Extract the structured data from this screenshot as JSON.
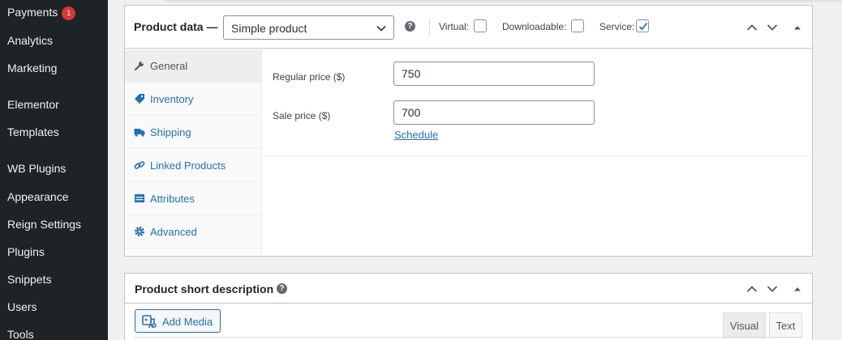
{
  "sidebar": {
    "items": [
      {
        "label": "Payments",
        "badge": "1"
      },
      {
        "label": "Analytics"
      },
      {
        "label": "Marketing"
      },
      {
        "label": "Elementor"
      },
      {
        "label": "Templates"
      },
      {
        "label": "WB Plugins"
      },
      {
        "label": "Appearance"
      },
      {
        "label": "Reign Settings"
      },
      {
        "label": "Plugins"
      },
      {
        "label": "Snippets"
      },
      {
        "label": "Users"
      },
      {
        "label": "Tools"
      }
    ]
  },
  "product_data": {
    "title": "Product data —",
    "type_select": {
      "selected": "Simple product"
    },
    "checkboxes": [
      {
        "label": "Virtual:",
        "checked": false
      },
      {
        "label": "Downloadable:",
        "checked": false
      },
      {
        "label": "Service:",
        "checked": true
      }
    ],
    "tabs": [
      {
        "label": "General",
        "icon": "wrench-icon",
        "active": true
      },
      {
        "label": "Inventory",
        "icon": "tag-icon"
      },
      {
        "label": "Shipping",
        "icon": "truck-icon"
      },
      {
        "label": "Linked Products",
        "icon": "link-icon"
      },
      {
        "label": "Attributes",
        "icon": "table-icon"
      },
      {
        "label": "Advanced",
        "icon": "gear-icon"
      }
    ],
    "fields": {
      "regular_price": {
        "label": "Regular price ($)",
        "value": "750"
      },
      "sale_price": {
        "label": "Sale price ($)",
        "value": "700"
      },
      "schedule_link": "Schedule"
    }
  },
  "short_description": {
    "title": "Product short description",
    "add_media_label": "Add Media",
    "editor_tabs": [
      "Visual",
      "Text"
    ]
  },
  "colors": {
    "sidebar_bg": "#1d2327",
    "link": "#2271b1",
    "badge": "#d63638"
  }
}
